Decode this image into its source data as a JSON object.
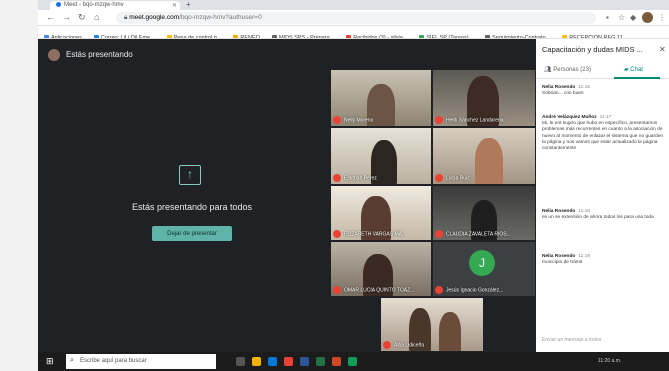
{
  "browser": {
    "tab_title": "Meet - bqo-mzqw-hmv",
    "url_host": "meet.google.com",
    "url_path": "/bqo-mzqw-hmv?authuser=0"
  },
  "bookmarks": [
    {
      "label": "Aplicaciones",
      "color": "#4285f4"
    },
    {
      "label": "Correo: LiLi Dil Eme...",
      "color": "#1e88e5"
    },
    {
      "label": "Pena de control p...",
      "color": "#fbbc04"
    },
    {
      "label": "RENEO",
      "color": "#f9ab00"
    },
    {
      "label": "MIDS SPS - Prepara...",
      "color": "#5f6368"
    },
    {
      "label": "Recibidos (3) - silvia...",
      "color": "#ea4335"
    },
    {
      "label": "SIEL SP (Tareas)...",
      "color": "#34a853"
    },
    {
      "label": "Seguimiento-Contrato...",
      "color": "#5f6368"
    },
    {
      "label": "RECEPCION REG 11...",
      "color": "#fbbc04"
    }
  ],
  "meet": {
    "presenting_header": "Estás presentando",
    "presenting_text": "Estás presentando para todos",
    "stop_button": "Dejar de presentar"
  },
  "tiles": [
    {
      "label": "Nelly Moreno"
    },
    {
      "label": "Heidi Sánchez Landarena"
    },
    {
      "label": "Esteban Pérez"
    },
    {
      "label": "Lucía Ruiz"
    },
    {
      "label": "ELIZABETH VARGAS MA..."
    },
    {
      "label": "CLAUDIA ZAVALETA RIOS..."
    },
    {
      "label": "OMAR LUCIA QUINTO TOAZ..."
    },
    {
      "label": "Jesús Ignacio González..."
    },
    {
      "label": "Alba Lidiceña"
    }
  ],
  "chat": {
    "title": "Capacitación y dudas MIDS ...",
    "tab_people": "Personas (23)",
    "tab_chat": "Chat",
    "messages": [
      {
        "sender": "Nelia Rosendo",
        "time": "11:16",
        "text": "Sobrian... con buen"
      },
      {
        "sender": "André Velázquez Muñoz",
        "time": "11:17",
        "text": "Mi, le ent sugiro que hubo en específico, presentamos problemas más recurrentes en cuanto a la asociación de nuevo al momento de enlazar el sistema que no guarden la página y nos vamos que estar actualizado la página constantemente"
      },
      {
        "sender": "Nelia Rosendo",
        "time": "11:18",
        "text": "es un se extensión de ahora todos los para una toda"
      },
      {
        "sender": "Nelia Rosendo",
        "time": "11:19",
        "text": "municipio de trámit"
      }
    ],
    "input_placeholder": "Enviar un mensaje a todos"
  },
  "taskbar": {
    "search_placeholder": "Escribe aquí para buscar",
    "tray_text": "11:20 a.m."
  }
}
